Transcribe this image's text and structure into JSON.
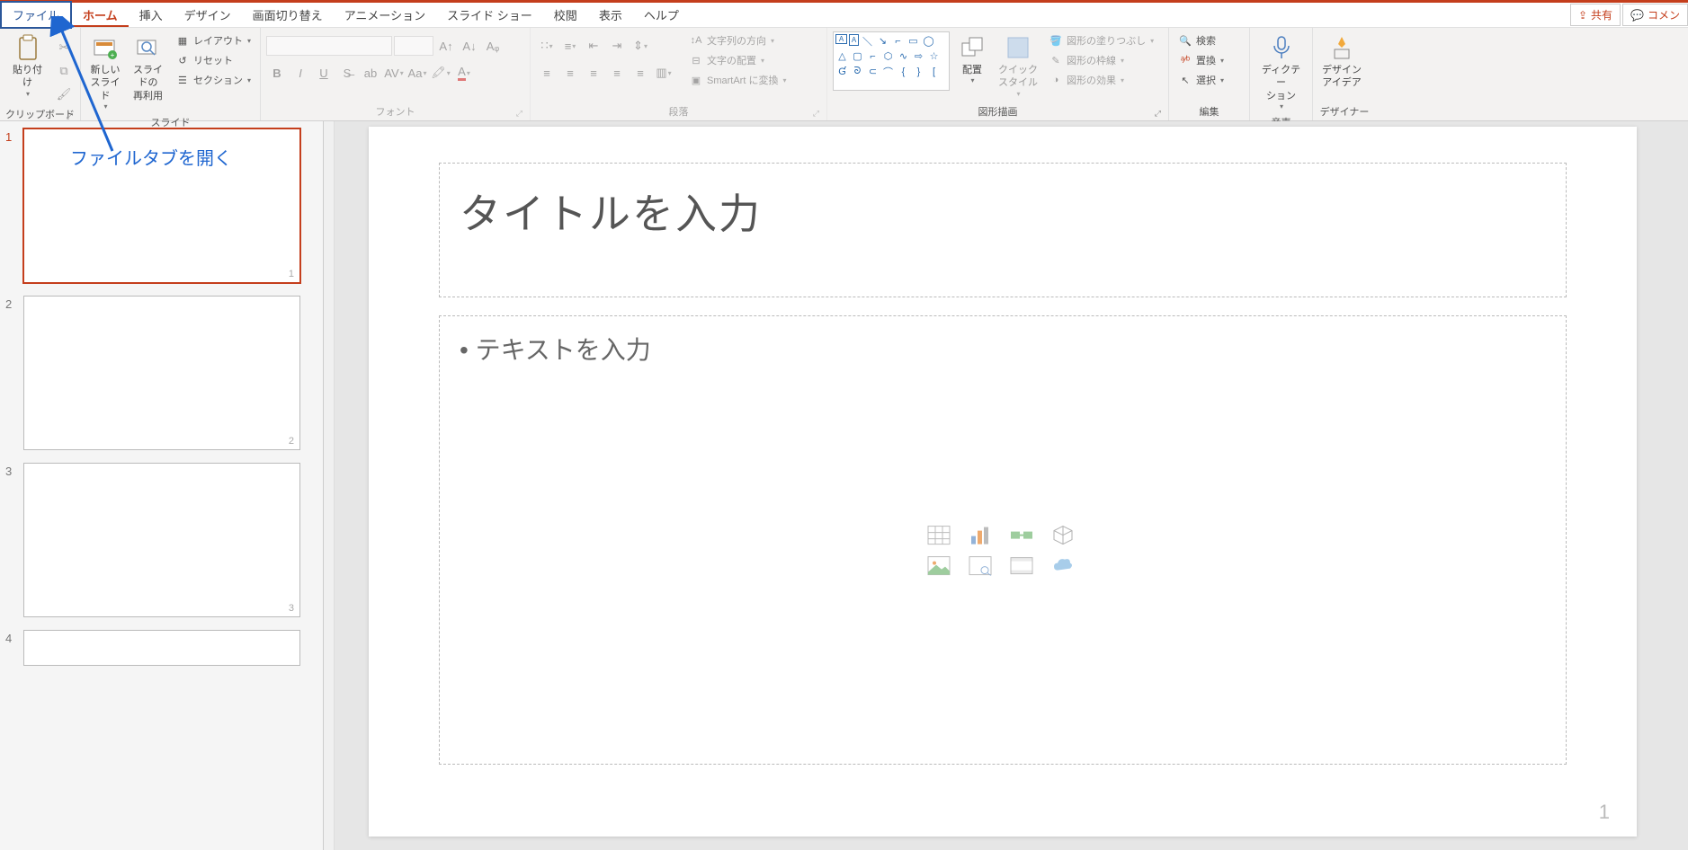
{
  "tabs": {
    "file": "ファイル",
    "home": "ホーム",
    "insert": "挿入",
    "design": "デザイン",
    "transitions": "画面切り替え",
    "animations": "アニメーション",
    "slideshow": "スライド ショー",
    "review": "校閲",
    "view": "表示",
    "help": "ヘルプ"
  },
  "topright": {
    "share": "共有",
    "comment": "コメン"
  },
  "ribbon": {
    "clipboard": {
      "label": "クリップボード",
      "paste": "貼り付け"
    },
    "slides": {
      "label": "スライド",
      "new_slide": "新しい\nスライド",
      "reuse": "スライドの\n再利用",
      "layout": "レイアウト",
      "reset": "リセット",
      "section": "セクション"
    },
    "font": {
      "label": "フォント"
    },
    "paragraph": {
      "label": "段落",
      "text_direction": "文字列の方向",
      "text_align": "文字の配置",
      "smartart": "SmartArt に変換"
    },
    "drawing": {
      "label": "図形描画",
      "arrange": "配置",
      "quick_styles": "クイック\nスタイル",
      "shape_fill": "図形の塗りつぶし",
      "shape_outline": "図形の枠線",
      "shape_effects": "図形の効果"
    },
    "editing": {
      "label": "編集",
      "find": "検索",
      "replace": "置換",
      "select": "選択"
    },
    "voice": {
      "label": "音声",
      "dictate": "ディクテー\nション"
    },
    "designer": {
      "label": "デザイナー",
      "ideas": "デザイン\nアイデア"
    }
  },
  "callout": "ファイルタブを開く",
  "slide": {
    "title_placeholder": "タイトルを入力",
    "body_placeholder": "• テキストを入力",
    "footer_number": "1"
  },
  "thumbnails": [
    {
      "num": "1",
      "page_ind": "1",
      "active": true
    },
    {
      "num": "2",
      "page_ind": "2",
      "active": false
    },
    {
      "num": "3",
      "page_ind": "3",
      "active": false
    },
    {
      "num": "4",
      "page_ind": "",
      "active": false
    }
  ]
}
